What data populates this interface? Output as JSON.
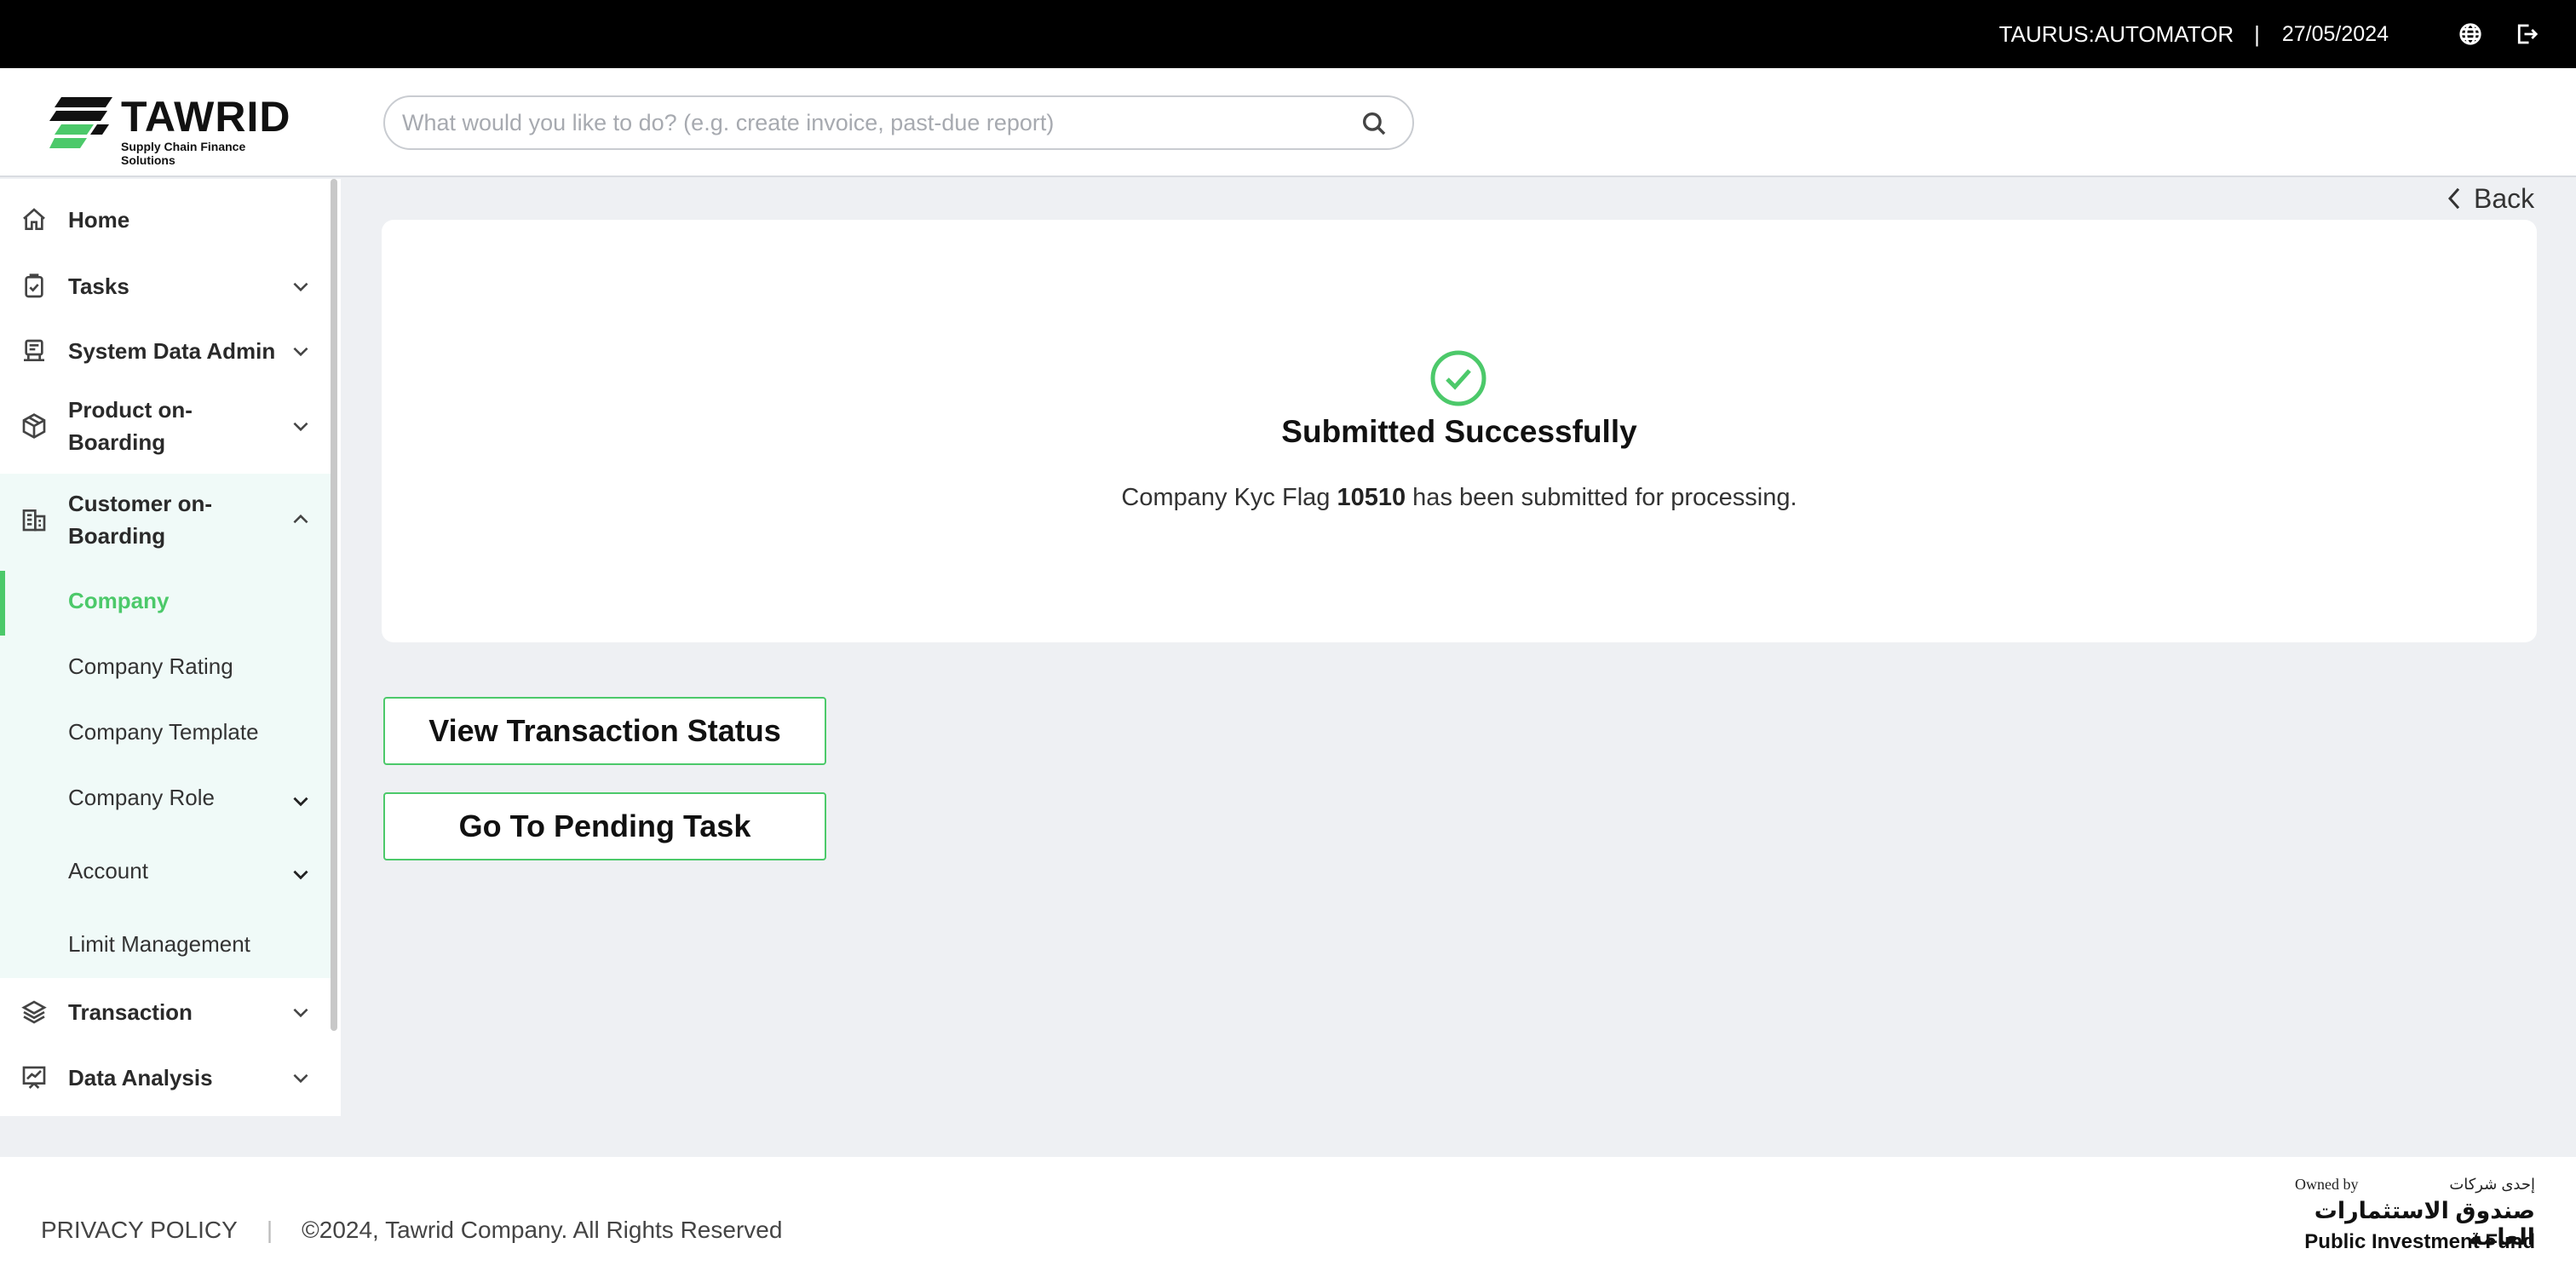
{
  "topbar": {
    "user": "TAURUS:AUTOMATOR",
    "separator": "|",
    "date": "27/05/2024",
    "icons": [
      "globe-icon",
      "logout-icon"
    ]
  },
  "header": {
    "brand": "TAWRID",
    "tagline": "Supply Chain Finance Solutions",
    "search_placeholder": "What would you like to do? (e.g. create invoice, past-due report)",
    "search_value": ""
  },
  "sidebar": {
    "items": [
      {
        "label": "Home",
        "icon": "home-icon"
      },
      {
        "label": "Tasks",
        "icon": "clipboard-check-icon"
      },
      {
        "label": "System Data Admin",
        "icon": "system-admin-icon"
      },
      {
        "label": "Product on-Boarding",
        "line1": "Product on-",
        "line2": "Boarding",
        "icon": "package-icon"
      },
      {
        "label": "Customer on-Boarding",
        "line1": "Customer on-",
        "line2": "Boarding",
        "icon": "building-icon"
      },
      {
        "label": "Transaction",
        "icon": "layers-icon"
      },
      {
        "label": "Data Analysis",
        "icon": "chart-icon"
      }
    ],
    "customer_onboarding_sub": [
      {
        "label": "Company",
        "active": true
      },
      {
        "label": "Company Rating"
      },
      {
        "label": "Company Template"
      },
      {
        "label": "Company Role",
        "has_children": true
      },
      {
        "label": "Account",
        "has_children": true
      },
      {
        "label": "Limit Management"
      }
    ]
  },
  "main": {
    "back_label": "Back",
    "success_title": "Submitted Successfully",
    "message_prefix": "Company Kyc Flag ",
    "message_id": "10510",
    "message_suffix": " has been submitted for processing.",
    "buttons": {
      "view_status": "View Transaction Status",
      "pending_task": "Go To Pending Task"
    }
  },
  "footer": {
    "privacy": "PRIVACY POLICY",
    "separator": "|",
    "copyright": "©2024, Tawrid Company. All Rights Reserved",
    "owned_by": "Owned by",
    "arabic_line1": "إحدى شركات",
    "arabic_line2": "صندوق الاستثمارات العامة",
    "pif_name": "Public Investment Fund"
  },
  "colors": {
    "accent": "#4cc96a",
    "topbar": "#000000",
    "background": "#eef0f3",
    "submenu_bg": "#f0faf8"
  }
}
